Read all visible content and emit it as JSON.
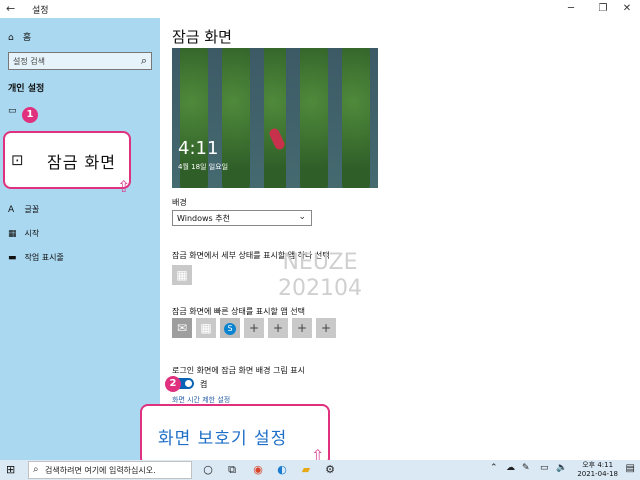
{
  "window": {
    "title": "설정",
    "back_icon": "back-arrow-icon",
    "minimize_icon": "minimize-icon",
    "maximize_icon": "restore-icon",
    "close_icon": "close-icon"
  },
  "sidebar": {
    "home_label": "홈",
    "search_placeholder": "설정 검색",
    "section_title": "개인 설정",
    "items": [
      {
        "label": "",
        "icon": "image-icon"
      },
      {
        "label": "잠금 화면",
        "icon": "lock-screen-icon"
      },
      {
        "label": "글꼴",
        "icon": "font-icon"
      },
      {
        "label": "시작",
        "icon": "start-icon"
      },
      {
        "label": "작업 표시줄",
        "icon": "taskbar-icon"
      }
    ]
  },
  "callouts": {
    "one": {
      "badge": "1",
      "label": "잠금 화면"
    },
    "two": {
      "badge": "2",
      "label": "화면 보호기 설정"
    }
  },
  "main": {
    "page_title": "잠금 화면",
    "preview": {
      "time": "4:11",
      "date": "4월 18일 일요일"
    },
    "background_label": "배경",
    "background_value": "Windows 추천",
    "detail_app_label": "잠금 화면에서 세부 상태를 표시할 앱 하나 선택",
    "quick_apps_label": "잠금 화면에 빠른 상태를 표시할 앱 선택",
    "quick_apps": [
      "mail-icon",
      "calendar-icon",
      "skype-icon",
      "+",
      "+",
      "+",
      "+"
    ],
    "signin_bg_label": "로그인 화면에 잠금 화면 배경 그림 표시",
    "toggle_state": "켬",
    "toggle_on": true,
    "timeout_link": "화면 시간 제한 설정",
    "watermark": [
      "NEUZE",
      "202104"
    ]
  },
  "taskbar": {
    "search_placeholder": "검색하려면 여기에 입력하십시오.",
    "ampm": "오후 4:11",
    "date": "2021-04-18"
  }
}
